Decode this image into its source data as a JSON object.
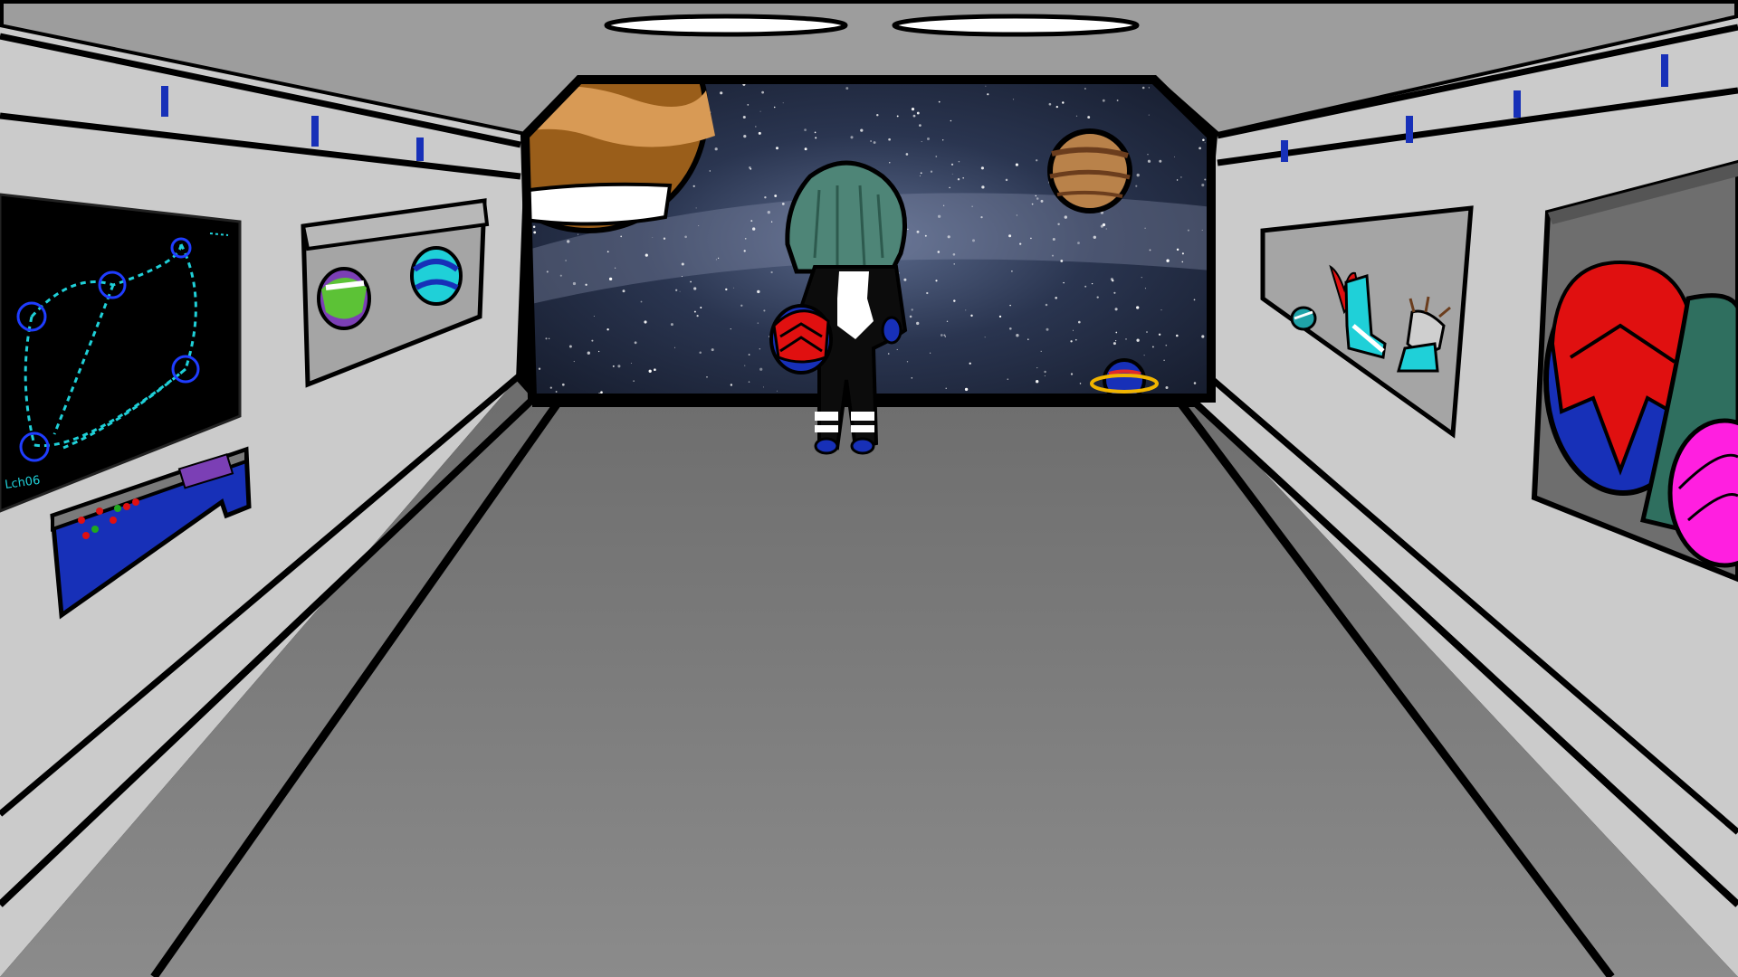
{
  "scene": {
    "title": "",
    "signature": "Lch06"
  },
  "colors": {
    "wall": "#c9c9c9",
    "ceiling": "#9a9a9a",
    "floor": "#7a7a7a",
    "accent_blue": "#1730b8",
    "map_line": "#1fd0d8",
    "space": "#1c2438"
  },
  "icons": [
    "star-map-screen",
    "control-console",
    "egg-green-purple",
    "egg-blue-teal",
    "flame-boot",
    "claw-glove",
    "teal-orb",
    "egg-red-blue",
    "egg-magenta",
    "gas-giant-planet",
    "striped-planet",
    "ringed-planet",
    "astronaut-character",
    "ceiling-light"
  ]
}
